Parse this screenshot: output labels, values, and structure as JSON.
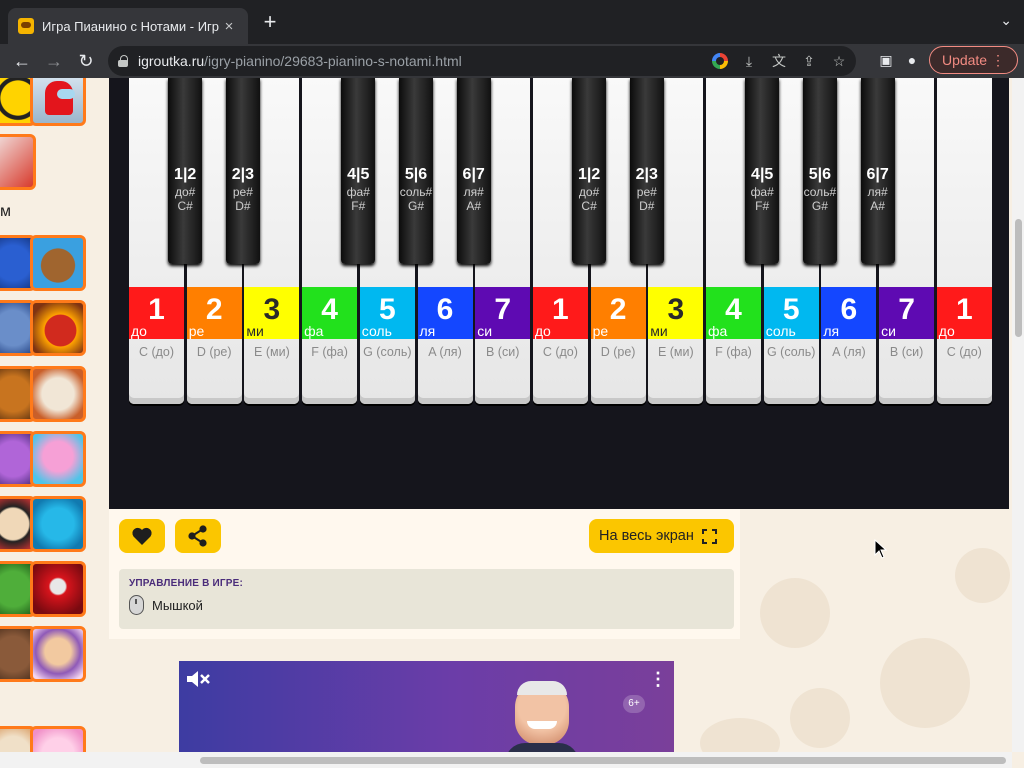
{
  "browser": {
    "tab_title": "Игра Пианино с Нотами - Игр",
    "url_domain": "igroutka.ru",
    "url_path": "/igry-pianino/29683-pianino-s-notami.html",
    "update_label": "Update",
    "icons": {
      "favicon": "game-face-icon",
      "close": "×",
      "new_tab": "+",
      "tab_menu": "⌄",
      "back": "←",
      "forward": "→",
      "reload": "↻",
      "install": "⤓",
      "translate": "文",
      "share": "⇪",
      "bookmark": "☆",
      "sidepanel": "▣",
      "profile": "●",
      "menu": "⋮"
    }
  },
  "sidebar": {
    "visible_letter": "м"
  },
  "piano": {
    "white_keys": [
      {
        "num": "1",
        "solf": "до",
        "name": "C (до)",
        "color": "#ff1a1a"
      },
      {
        "num": "2",
        "solf": "ре",
        "name": "D (ре)",
        "color": "#ff7f00"
      },
      {
        "num": "3",
        "solf": "ми",
        "name": "E (ми)",
        "color": "#ffff00"
      },
      {
        "num": "4",
        "solf": "фа",
        "name": "F (фа)",
        "color": "#22e11c"
      },
      {
        "num": "5",
        "solf": "соль",
        "name": "G (соль)",
        "color": "#00b8f0"
      },
      {
        "num": "6",
        "solf": "ля",
        "name": "A (ля)",
        "color": "#1447ff"
      },
      {
        "num": "7",
        "solf": "си",
        "name": "B (си)",
        "color": "#5e0ab2"
      },
      {
        "num": "1",
        "solf": "до",
        "name": "C (до)",
        "color": "#ff1a1a"
      },
      {
        "num": "2",
        "solf": "ре",
        "name": "D (ре)",
        "color": "#ff7f00"
      },
      {
        "num": "3",
        "solf": "ми",
        "name": "E (ми)",
        "color": "#ffff00"
      },
      {
        "num": "4",
        "solf": "фа",
        "name": "F (фа)",
        "color": "#22e11c"
      },
      {
        "num": "5",
        "solf": "соль",
        "name": "G (соль)",
        "color": "#00b8f0"
      },
      {
        "num": "6",
        "solf": "ля",
        "name": "A (ля)",
        "color": "#1447ff"
      },
      {
        "num": "7",
        "solf": "си",
        "name": "B (си)",
        "color": "#5e0ab2"
      },
      {
        "num": "1",
        "solf": "до",
        "name": "C (до)",
        "color": "#ff1a1a"
      }
    ],
    "black_keys": [
      {
        "num": "1|2",
        "solf": "до#",
        "note": "C#"
      },
      {
        "num": "2|3",
        "solf": "ре#",
        "note": "D#"
      },
      {
        "num": "4|5",
        "solf": "фа#",
        "note": "F#"
      },
      {
        "num": "5|6",
        "solf": "соль#",
        "note": "G#"
      },
      {
        "num": "6|7",
        "solf": "ля#",
        "note": "A#"
      },
      {
        "num": "1|2",
        "solf": "до#",
        "note": "C#"
      },
      {
        "num": "2|3",
        "solf": "ре#",
        "note": "D#"
      },
      {
        "num": "4|5",
        "solf": "фа#",
        "note": "F#"
      },
      {
        "num": "5|6",
        "solf": "соль#",
        "note": "G#"
      },
      {
        "num": "6|7",
        "solf": "ля#",
        "note": "A#"
      }
    ]
  },
  "controls": {
    "like_icon": "heart-icon",
    "share_icon": "share-icon",
    "fullscreen_label": "На весь экран",
    "control_title": "УПРАВЛЕНИЕ В ИГРЕ:",
    "control_text": "Мышкой"
  },
  "video_ad": {
    "age_label": "6+",
    "mute_icon": "muted-speaker-icon",
    "menu_icon": "⋮"
  },
  "colors": {
    "accent": "#fbc600",
    "thumb_border": "#ff7a1a",
    "chrome_dark": "#202124"
  }
}
